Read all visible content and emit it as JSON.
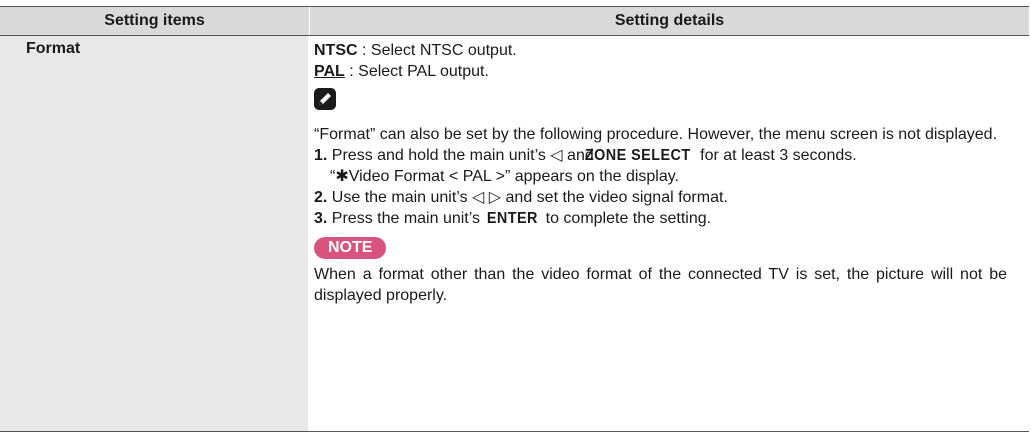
{
  "table": {
    "header": {
      "col1": "Setting items",
      "col2": "Setting details"
    },
    "row": {
      "item": "Format",
      "ntsc_label": "NTSC",
      "ntsc_text": " : Select NTSC output.",
      "pal_label": "PAL",
      "pal_text": " : Select PAL output.",
      "info_text": "“Format” can also be set by the following procedure. However, the menu screen is not displayed.",
      "step1_num": "1.",
      "step1_pre": " Press and hold the main unit’s ",
      "step1_btn": "ZONE SELECT",
      "step1_post": " for at least 3 seconds.",
      "step1_display": "“✱Video Format < PAL >” appears on the display.",
      "step2_num": "2.",
      "step2_text": " and set the video signal format.",
      "step2_pre": " Use the main unit’s ",
      "step3_num": "3.",
      "step3_pre": " Press the main unit’s ",
      "step3_btn": "ENTER",
      "step3_post": " to complete the setting.",
      "note_label": "NOTE",
      "note_text": "When a format other than the video format of the connected TV is set, the picture will not be displayed properly."
    }
  }
}
